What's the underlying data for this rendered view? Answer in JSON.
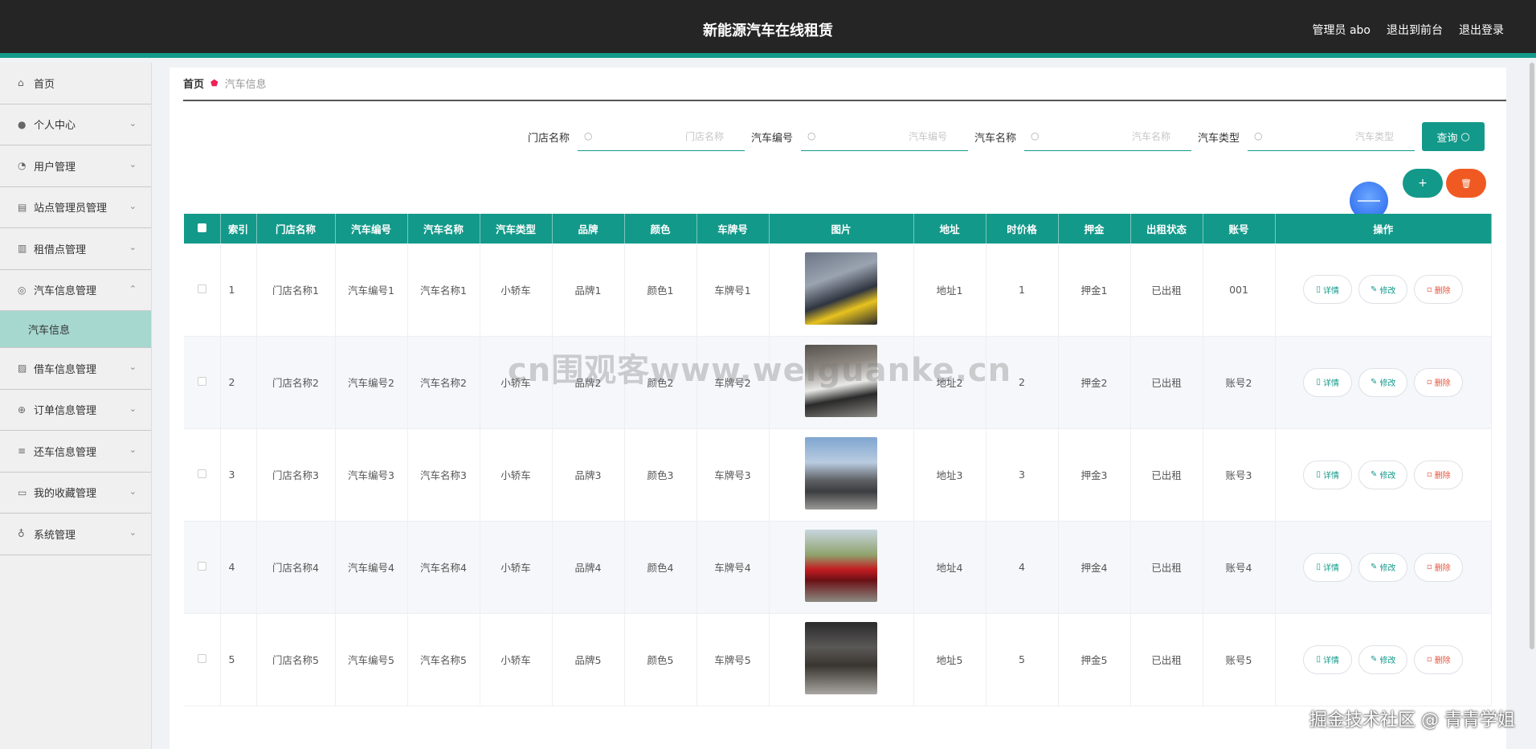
{
  "header": {
    "title": "新能源汽车在线租赁",
    "admin": "管理员 abo",
    "front": "退出到前台",
    "logout": "退出登录"
  },
  "sidebar": {
    "items": [
      {
        "label": "首页",
        "icon": "home-icon"
      },
      {
        "label": "个人中心",
        "icon": "user-icon"
      },
      {
        "label": "用户管理",
        "icon": "gauge-icon"
      },
      {
        "label": "站点管理员管理",
        "icon": "clipboard-icon"
      },
      {
        "label": "租借点管理",
        "icon": "bar-chart-icon"
      },
      {
        "label": "汽车信息管理",
        "icon": "compass-icon"
      },
      {
        "label": "借车信息管理",
        "icon": "image-icon"
      },
      {
        "label": "订单信息管理",
        "icon": "target-icon"
      },
      {
        "label": "还车信息管理",
        "icon": "sliders-icon"
      },
      {
        "label": "我的收藏管理",
        "icon": "briefcase-icon"
      },
      {
        "label": "系统管理",
        "icon": "bulb-icon"
      }
    ],
    "sub_active": "汽车信息"
  },
  "breadcrumb": {
    "home": "首页",
    "current": "汽车信息"
  },
  "search": {
    "store_label": "门店名称",
    "store_ph": "门店名称",
    "code_label": "汽车编号",
    "code_ph": "汽车编号",
    "name_label": "汽车名称",
    "name_ph": "汽车名称",
    "type_label": "汽车类型",
    "type_ph": "汽车类型",
    "query": "查询"
  },
  "actions": {
    "add": "+",
    "delete": "🗑"
  },
  "table": {
    "headers": [
      "索引",
      "门店名称",
      "汽车编号",
      "汽车名称",
      "汽车类型",
      "品牌",
      "颜色",
      "车牌号",
      "图片",
      "地址",
      "时价格",
      "押金",
      "出租状态",
      "账号",
      "操作"
    ],
    "rows": [
      {
        "idx": "1",
        "store": "门店名称1",
        "code": "汽车编号1",
        "name": "汽车名称1",
        "type": "小轿车",
        "brand": "品牌1",
        "color": "颜色1",
        "plate": "车牌号1",
        "addr": "地址1",
        "price": "1",
        "deposit": "押金1",
        "status": "已出租",
        "account": "001"
      },
      {
        "idx": "2",
        "store": "门店名称2",
        "code": "汽车编号2",
        "name": "汽车名称2",
        "type": "小轿车",
        "brand": "品牌2",
        "color": "颜色2",
        "plate": "车牌号2",
        "addr": "地址2",
        "price": "2",
        "deposit": "押金2",
        "status": "已出租",
        "account": "账号2"
      },
      {
        "idx": "3",
        "store": "门店名称3",
        "code": "汽车编号3",
        "name": "汽车名称3",
        "type": "小轿车",
        "brand": "品牌3",
        "color": "颜色3",
        "plate": "车牌号3",
        "addr": "地址3",
        "price": "3",
        "deposit": "押金3",
        "status": "已出租",
        "account": "账号3"
      },
      {
        "idx": "4",
        "store": "门店名称4",
        "code": "汽车编号4",
        "name": "汽车名称4",
        "type": "小轿车",
        "brand": "品牌4",
        "color": "颜色4",
        "plate": "车牌号4",
        "addr": "地址4",
        "price": "4",
        "deposit": "押金4",
        "status": "已出租",
        "account": "账号4"
      },
      {
        "idx": "5",
        "store": "门店名称5",
        "code": "汽车编号5",
        "name": "汽车名称5",
        "type": "小轿车",
        "brand": "品牌5",
        "color": "颜色5",
        "plate": "车牌号5",
        "addr": "地址5",
        "price": "5",
        "deposit": "押金5",
        "status": "已出租",
        "account": "账号5"
      }
    ],
    "ops": {
      "detail": "详情",
      "edit": "修改",
      "delete": "删除"
    }
  },
  "watermarks": {
    "center": "cn围观客www.weiguanke.cn",
    "corner": "掘金技术社区 @ 青青学姐"
  },
  "colors": {
    "accent": "#13998a",
    "danger": "#f05a22",
    "topbar": "#252525"
  }
}
